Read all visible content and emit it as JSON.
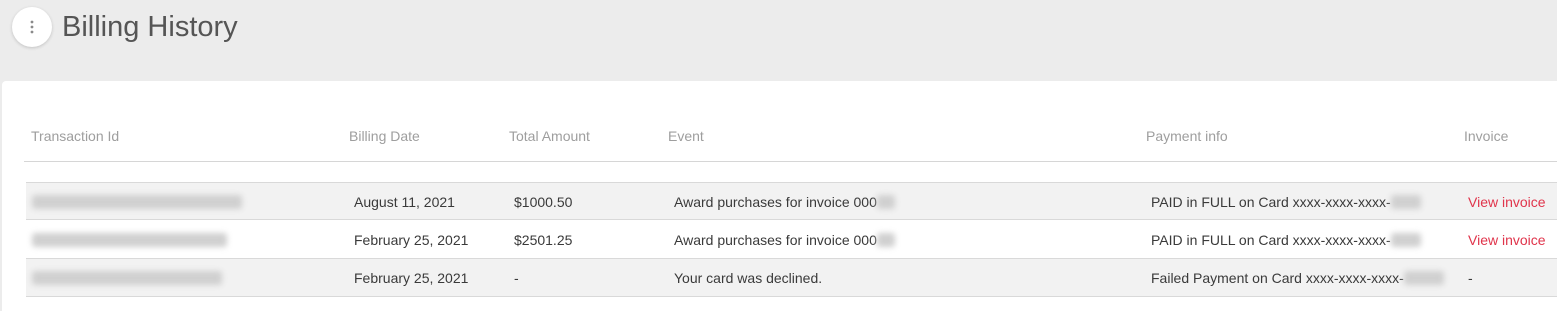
{
  "header": {
    "title": "Billing History",
    "menu_icon": "more-vertical-icon"
  },
  "table": {
    "columns": [
      "Transaction Id",
      "Billing Date",
      "Total Amount",
      "Event",
      "Payment info",
      "Invoice"
    ],
    "rows": [
      {
        "billing_date": "August 11, 2021",
        "total_amount": "$1000.50",
        "event": "Award purchases for invoice 000",
        "payment_info": "PAID in FULL on Card xxxx-xxxx-xxxx-",
        "invoice": "View invoice"
      },
      {
        "billing_date": "February 25, 2021",
        "total_amount": "$2501.25",
        "event": "Award purchases for invoice 000",
        "payment_info": "PAID in FULL on Card xxxx-xxxx-xxxx-",
        "invoice": "View invoice"
      },
      {
        "billing_date": "February 25, 2021",
        "total_amount": "-",
        "event": "Your card was declined.",
        "payment_info": "Failed Payment on Card xxxx-xxxx-xxxx-",
        "invoice": "-"
      }
    ]
  },
  "colors": {
    "background": "#ececec",
    "card": "#ffffff",
    "link": "#e0344b",
    "header_text": "#9e9e9e"
  }
}
